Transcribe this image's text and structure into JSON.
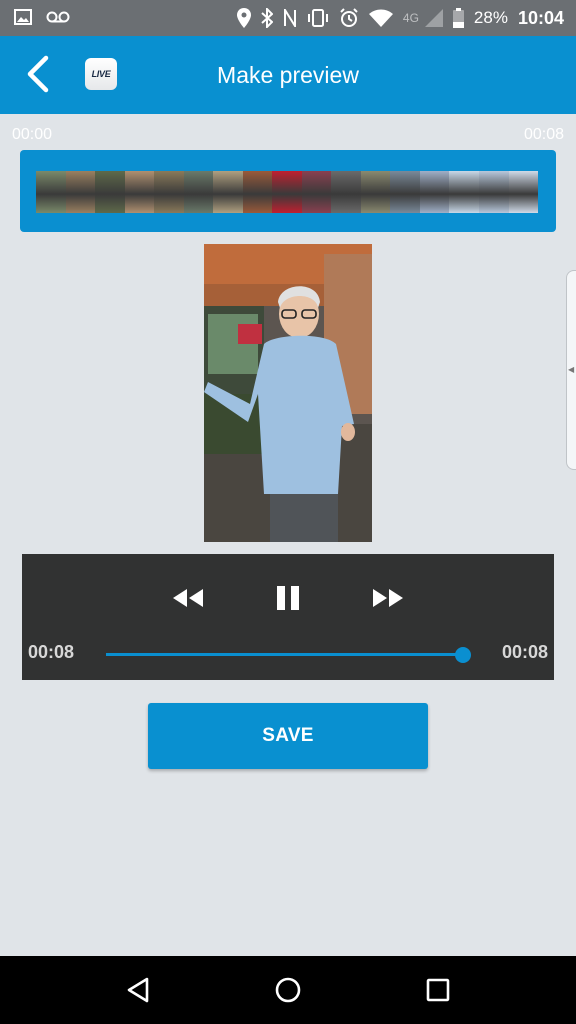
{
  "status_bar": {
    "network": "4G",
    "battery": "28%",
    "time": "10:04",
    "icons": [
      "image-icon",
      "voicemail-icon",
      "location-icon",
      "bluetooth-icon",
      "nfc-icon",
      "vibrate-icon",
      "alarm-icon",
      "wifi-icon",
      "signal-icon",
      "battery-icon"
    ]
  },
  "app_bar": {
    "title": "Make preview",
    "logo_text": "LIVE",
    "back_icon": "chevron-left-icon"
  },
  "timeline": {
    "start": "00:00",
    "end": "00:08",
    "frame_colors": [
      "#7a8a6a",
      "#9a8060",
      "#5e6a4a",
      "#b09070",
      "#8a7a5a",
      "#6a7a6a",
      "#b0a080",
      "#9a5a3a",
      "#c02030",
      "#8a4050",
      "#6a6a6a",
      "#8a8a70",
      "#7a8a9a",
      "#a0b0c8",
      "#c8d8e8",
      "#b8c8dc",
      "#d0dae8"
    ]
  },
  "player": {
    "current_time": "00:08",
    "duration": "00:08",
    "progress": 1.0,
    "controls": [
      "rewind-icon",
      "pause-icon",
      "fast-forward-icon"
    ]
  },
  "save_button": {
    "label": "SAVE"
  },
  "colors": {
    "primary": "#0990d0",
    "player_bg": "#313232",
    "page_bg": "#e0e4e8"
  }
}
